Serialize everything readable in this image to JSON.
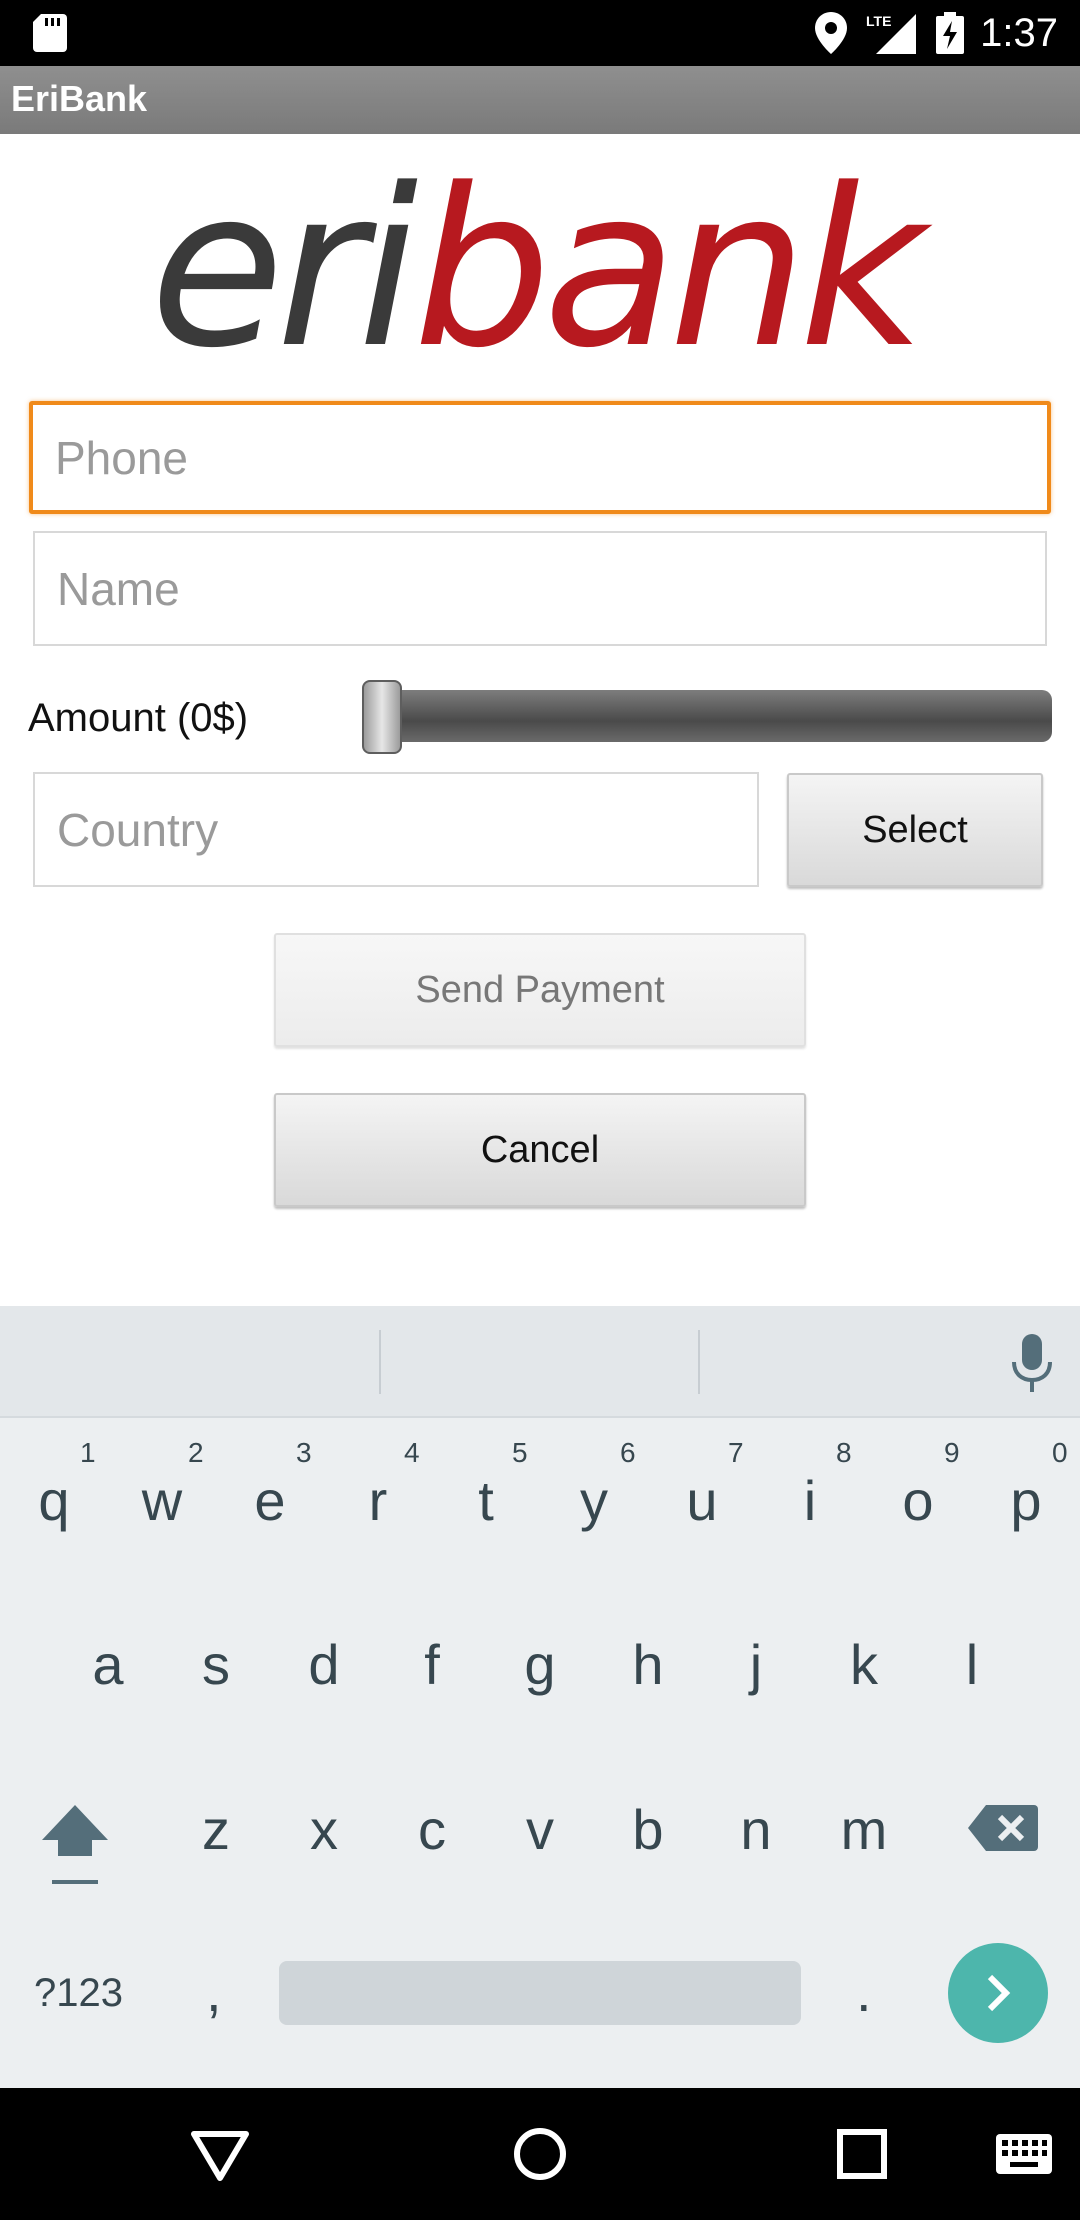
{
  "status_bar": {
    "time": "1:37",
    "network": "LTE"
  },
  "app_bar": {
    "title": "EriBank"
  },
  "logo": {
    "part1": "eri",
    "part2": "bank"
  },
  "form": {
    "phone_placeholder": "Phone",
    "name_placeholder": "Name",
    "amount_label": "Amount (0$)",
    "amount_value": 0,
    "country_placeholder": "Country",
    "select_label": "Select",
    "send_label": "Send Payment",
    "cancel_label": "Cancel"
  },
  "keyboard": {
    "row1": [
      "q",
      "w",
      "e",
      "r",
      "t",
      "y",
      "u",
      "i",
      "o",
      "p"
    ],
    "row1_hints": [
      "1",
      "2",
      "3",
      "4",
      "5",
      "6",
      "7",
      "8",
      "9",
      "0"
    ],
    "row2": [
      "a",
      "s",
      "d",
      "f",
      "g",
      "h",
      "j",
      "k",
      "l"
    ],
    "row3": [
      "z",
      "x",
      "c",
      "v",
      "b",
      "n",
      "m"
    ],
    "symbols_label": "?123",
    "comma": ",",
    "period": ".",
    "accent_color": "#4db6ac"
  },
  "icons": [
    "sd-card-icon",
    "location-icon",
    "signal-icon",
    "battery-icon",
    "mic-icon",
    "shift-icon",
    "backspace-icon",
    "enter-icon",
    "back-icon",
    "home-icon",
    "recents-icon",
    "keyboard-icon"
  ]
}
